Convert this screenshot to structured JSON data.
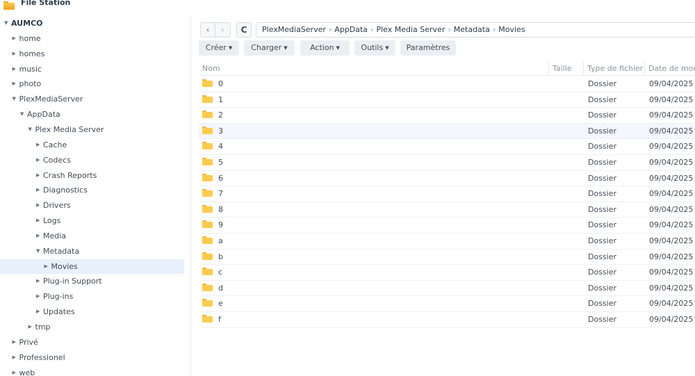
{
  "window": {
    "title": "File Station"
  },
  "sidebar": {
    "items": [
      {
        "label": "AUMCO",
        "caret": "▼",
        "level": 0,
        "root": true,
        "selected": false
      },
      {
        "label": "home",
        "caret": "▶",
        "level": 1,
        "selected": false
      },
      {
        "label": "homes",
        "caret": "▶",
        "level": 1,
        "selected": false
      },
      {
        "label": "music",
        "caret": "▶",
        "level": 1,
        "selected": false
      },
      {
        "label": "photo",
        "caret": "▶",
        "level": 1,
        "selected": false
      },
      {
        "label": "PlexMediaServer",
        "caret": "▼",
        "level": 1,
        "selected": false
      },
      {
        "label": "AppData",
        "caret": "▼",
        "level": 2,
        "selected": false
      },
      {
        "label": "Plex Media Server",
        "caret": "▼",
        "level": 3,
        "selected": false
      },
      {
        "label": "Cache",
        "caret": "▶",
        "level": 4,
        "selected": false
      },
      {
        "label": "Codecs",
        "caret": "▶",
        "level": 4,
        "selected": false
      },
      {
        "label": "Crash Reports",
        "caret": "▶",
        "level": 4,
        "selected": false
      },
      {
        "label": "Diagnostics",
        "caret": "▶",
        "level": 4,
        "selected": false
      },
      {
        "label": "Drivers",
        "caret": "▶",
        "level": 4,
        "selected": false
      },
      {
        "label": "Logs",
        "caret": "▶",
        "level": 4,
        "selected": false
      },
      {
        "label": "Media",
        "caret": "▶",
        "level": 4,
        "selected": false
      },
      {
        "label": "Metadata",
        "caret": "▼",
        "level": 4,
        "selected": false
      },
      {
        "label": "Movies",
        "caret": "▶",
        "level": 5,
        "selected": true
      },
      {
        "label": "Plug-in Support",
        "caret": "▶",
        "level": 4,
        "selected": false
      },
      {
        "label": "Plug-ins",
        "caret": "▶",
        "level": 4,
        "selected": false
      },
      {
        "label": "Updates",
        "caret": "▶",
        "level": 4,
        "selected": false
      },
      {
        "label": "tmp",
        "caret": "▶",
        "level": 3,
        "selected": false
      },
      {
        "label": "Privé",
        "caret": "▶",
        "level": 1,
        "selected": false
      },
      {
        "label": "Professionel",
        "caret": "▶",
        "level": 1,
        "selected": false
      },
      {
        "label": "web",
        "caret": "▶",
        "level": 1,
        "selected": false
      }
    ]
  },
  "navigation": {
    "back_icon": "chevron-left-icon",
    "forward_icon": "chevron-right-icon",
    "refresh_icon": "refresh-icon",
    "back_glyph": "‹",
    "forward_glyph": "›",
    "refresh_glyph": "C",
    "breadcrumb": [
      "PlexMediaServer",
      "AppData",
      "Plex Media Server",
      "Metadata",
      "Movies"
    ],
    "separator": "›"
  },
  "toolbar": {
    "buttons": [
      {
        "label": "Créer",
        "dropdown": true
      },
      {
        "label": "Charger",
        "dropdown": true
      },
      {
        "label": "Action",
        "dropdown": true
      },
      {
        "label": "Outils",
        "dropdown": true
      },
      {
        "label": "Paramètres",
        "dropdown": false
      }
    ],
    "dropdown_glyph": "▼"
  },
  "table": {
    "columns": {
      "name": "Nom",
      "size": "Taille",
      "type": "Type de fichier",
      "date": "Date de mod"
    },
    "rows": [
      {
        "name": "0",
        "size": "",
        "type": "Dossier",
        "date": "09/04/2025"
      },
      {
        "name": "1",
        "size": "",
        "type": "Dossier",
        "date": "09/04/2025"
      },
      {
        "name": "2",
        "size": "",
        "type": "Dossier",
        "date": "09/04/2025"
      },
      {
        "name": "3",
        "size": "",
        "type": "Dossier",
        "date": "09/04/2025"
      },
      {
        "name": "4",
        "size": "",
        "type": "Dossier",
        "date": "09/04/2025"
      },
      {
        "name": "5",
        "size": "",
        "type": "Dossier",
        "date": "09/04/2025"
      },
      {
        "name": "6",
        "size": "",
        "type": "Dossier",
        "date": "09/04/2025"
      },
      {
        "name": "7",
        "size": "",
        "type": "Dossier",
        "date": "09/04/2025"
      },
      {
        "name": "8",
        "size": "",
        "type": "Dossier",
        "date": "09/04/2025"
      },
      {
        "name": "9",
        "size": "",
        "type": "Dossier",
        "date": "09/04/2025"
      },
      {
        "name": "a",
        "size": "",
        "type": "Dossier",
        "date": "09/04/2025"
      },
      {
        "name": "b",
        "size": "",
        "type": "Dossier",
        "date": "09/04/2025"
      },
      {
        "name": "c",
        "size": "",
        "type": "Dossier",
        "date": "09/04/2025"
      },
      {
        "name": "d",
        "size": "",
        "type": "Dossier",
        "date": "09/04/2025"
      },
      {
        "name": "e",
        "size": "",
        "type": "Dossier",
        "date": "09/04/2025"
      },
      {
        "name": "f",
        "size": "",
        "type": "Dossier",
        "date": "09/04/2025"
      }
    ]
  },
  "colors": {
    "folder": "#ffcb4f",
    "selection": "#e8f0fb",
    "accent": "#f5a623"
  }
}
